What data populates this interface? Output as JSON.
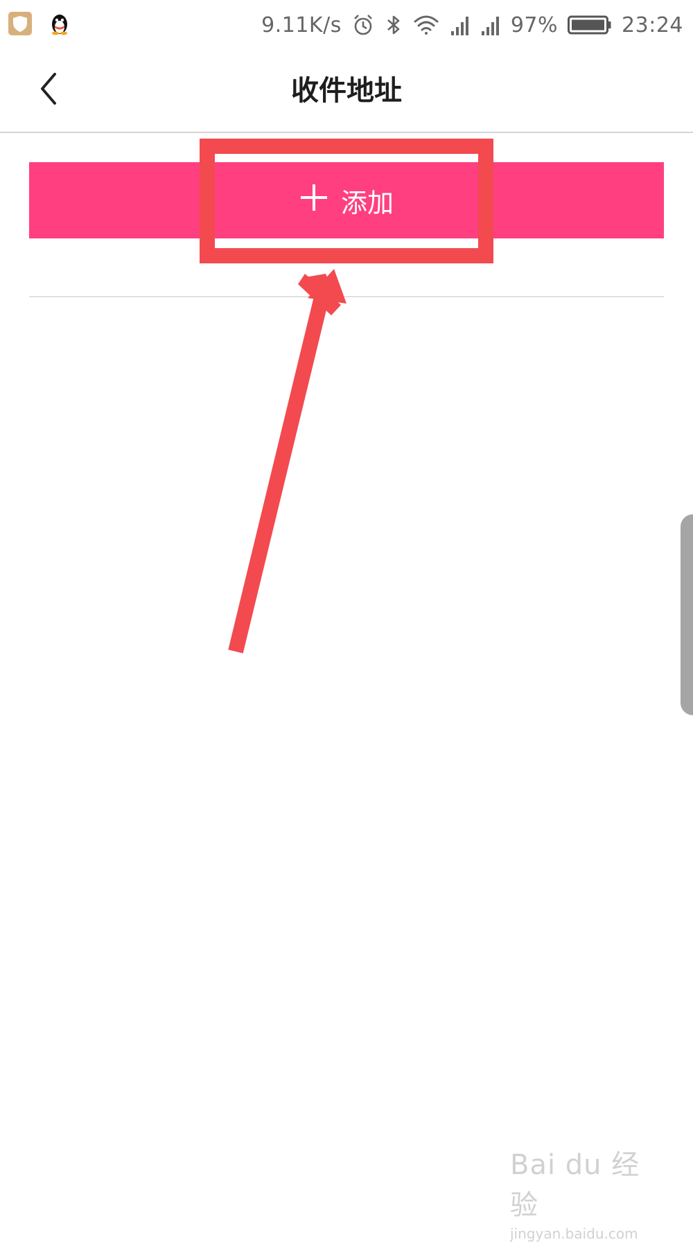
{
  "status_bar": {
    "network_speed": "9.11K/s",
    "battery_percent": "97%",
    "time": "23:24",
    "icons": [
      "security-shield-icon",
      "qq-penguin-icon",
      "alarm-icon",
      "bluetooth-icon",
      "wifi-icon",
      "signal-icon",
      "signal-icon",
      "battery-icon"
    ]
  },
  "header": {
    "title": "收件地址"
  },
  "main": {
    "add_button": {
      "plus_icon": "plus-icon",
      "label": "添加"
    }
  },
  "watermark": {
    "brand": "Bai du 经验",
    "url": "jingyan.baidu.com"
  },
  "colors": {
    "accent": "#ff3f80",
    "annotation": "#f24a4f"
  }
}
